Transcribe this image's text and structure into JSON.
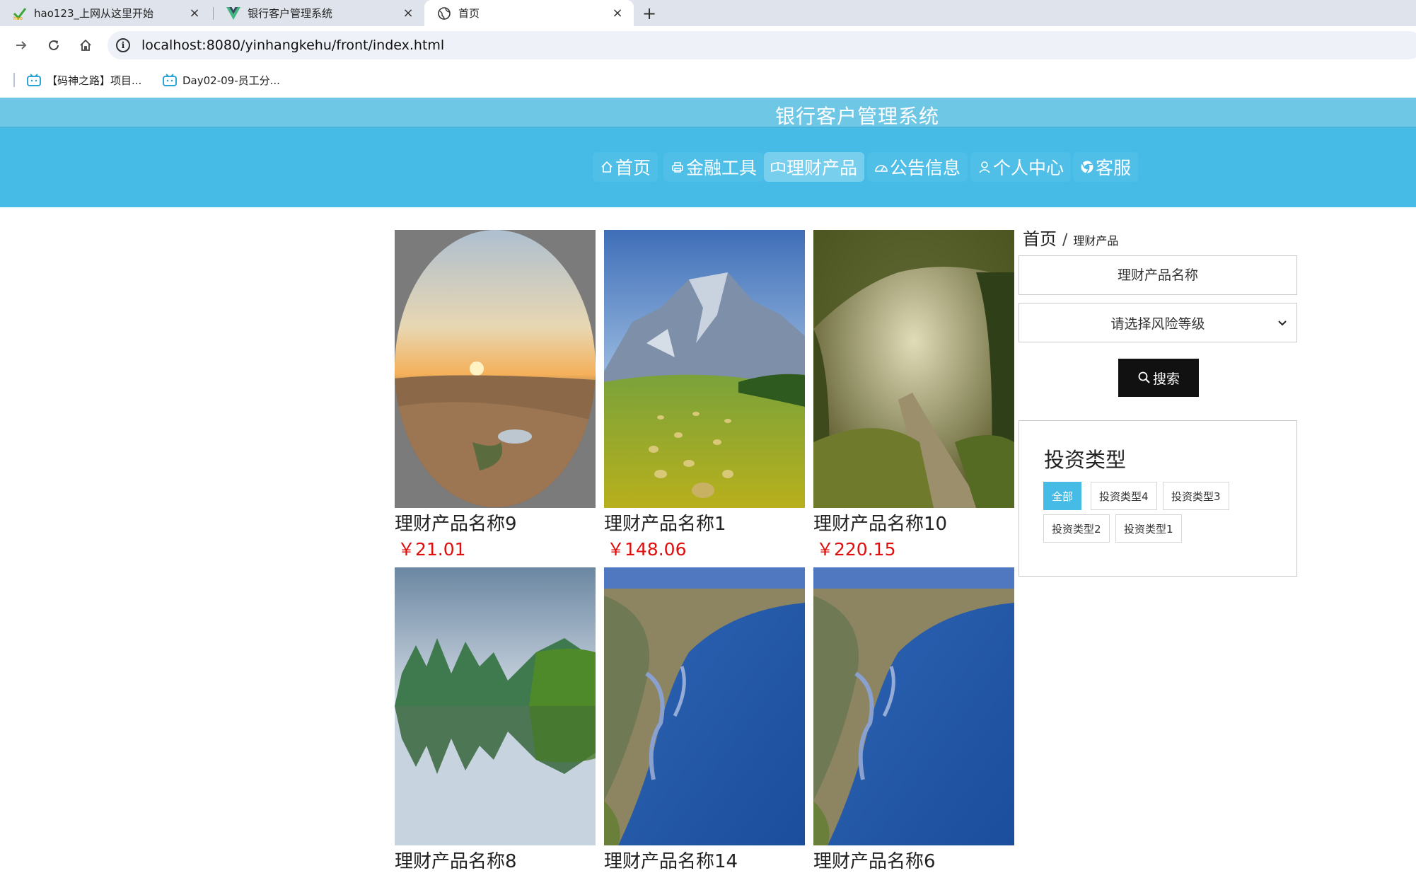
{
  "browser": {
    "tabs": [
      {
        "title": "hao123_上网从这里开始",
        "close": "×"
      },
      {
        "title": "银行客户管理系统",
        "close": "×"
      },
      {
        "title": "首页",
        "close": "×"
      }
    ],
    "new_tab": "+",
    "url": "localhost:8080/yinhangkehu/front/index.html",
    "bookmarks": [
      {
        "label": "【码神之路】项目..."
      },
      {
        "label": "Day02-09-员工分..."
      }
    ]
  },
  "site": {
    "title": "银行客户管理系统",
    "nav": [
      {
        "label": "首页",
        "icon": "home-icon"
      },
      {
        "label": "金融工具",
        "icon": "printer-icon"
      },
      {
        "label": "理财产品",
        "icon": "reading-icon"
      },
      {
        "label": "公告信息",
        "icon": "odometer-icon"
      },
      {
        "label": "个人中心",
        "icon": "user-icon"
      },
      {
        "label": "客服",
        "icon": "chrome-icon"
      }
    ],
    "active_nav": "理财产品"
  },
  "products": [
    {
      "name": "理财产品名称9",
      "price": "￥21.01",
      "image": "desert-sunset-oval"
    },
    {
      "name": "理财产品名称1",
      "price": "￥148.06",
      "image": "mountain-hay-field"
    },
    {
      "name": "理财产品名称10",
      "price": "￥220.15",
      "image": "misty-forest-path"
    },
    {
      "name": "理财产品名称8",
      "image": "karst-river-reflection"
    },
    {
      "name": "理财产品名称14",
      "image": "lake-shoreline-aerial"
    },
    {
      "name": "理财产品名称6",
      "image": "lake-shoreline-aerial"
    }
  ],
  "sidebar": {
    "breadcrumb": {
      "home": "首页",
      "separator": "/",
      "current": "理财产品"
    },
    "search_placeholder": "理财产品名称",
    "risk_select": "请选择风险等级",
    "search_button": "搜索",
    "type_panel": {
      "title": "投资类型",
      "tags": [
        "全部",
        "投资类型4",
        "投资类型3",
        "投资类型2",
        "投资类型1"
      ],
      "active": "全部"
    }
  },
  "colors": {
    "title_bar": "#6ec7e5",
    "navbar": "#45bbe6",
    "price": "#e10d0d",
    "search_button": "#111111"
  }
}
